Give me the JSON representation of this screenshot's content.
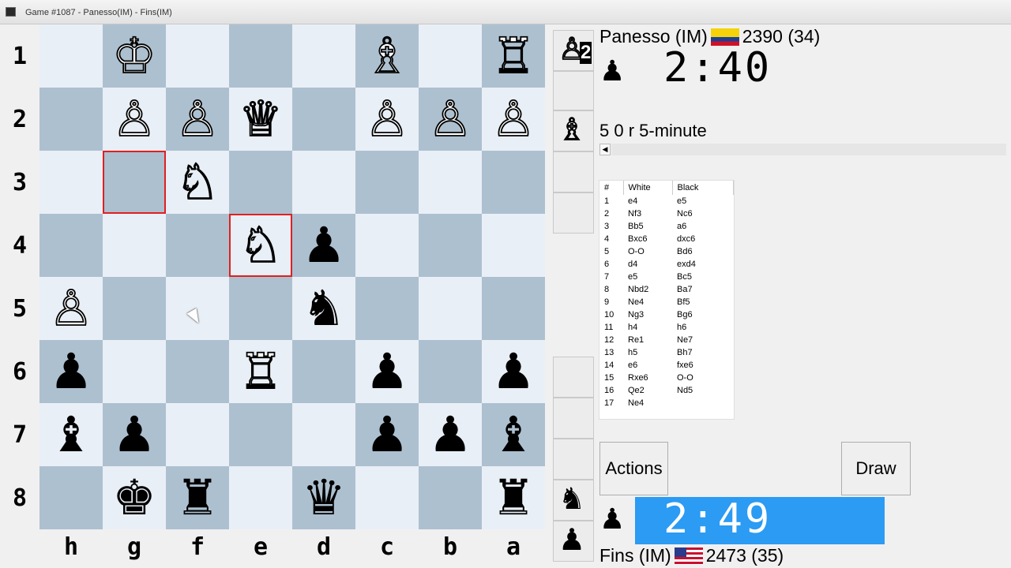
{
  "window": {
    "title": "Game #1087 - Panesso(IM) - Fins(IM)"
  },
  "board": {
    "rank_labels": [
      "1",
      "2",
      "3",
      "4",
      "5",
      "6",
      "7",
      "8"
    ],
    "file_labels": [
      "h",
      "g",
      "f",
      "e",
      "d",
      "c",
      "b",
      "a"
    ],
    "rows": [
      [
        "",
        "K",
        "",
        "",
        "",
        "B",
        "",
        "R"
      ],
      [
        "",
        "P",
        "P",
        "Q",
        "",
        "P",
        "P",
        "P"
      ],
      [
        "",
        "",
        "N",
        "",
        "",
        "",
        "",
        ""
      ],
      [
        "",
        "",
        "",
        "N",
        "p",
        "",
        "",
        ""
      ],
      [
        "P",
        "",
        "",
        "",
        "n",
        "",
        "",
        ""
      ],
      [
        "p",
        "",
        "",
        "R",
        "",
        "p",
        "",
        "p"
      ],
      [
        "b",
        "p",
        "",
        "",
        "",
        "p",
        "p",
        "b"
      ],
      [
        "",
        "k",
        "r",
        "",
        "q",
        "",
        "",
        "r"
      ]
    ],
    "highlighted": [
      "g3",
      "e4"
    ]
  },
  "captured": {
    "top": {
      "piece_icon": "white-pawn-icon",
      "glyph": "♙",
      "count": "2",
      "second_icon": "white-bishop-icon",
      "second_glyph": "♗"
    },
    "bottom": {
      "piece_icon": "black-knight-icon",
      "glyph": "♞",
      "second_icon": "black-pawn-icon",
      "second_glyph": "♟"
    }
  },
  "black_player": {
    "name": "Panesso (IM)",
    "rating": "2390 (34)",
    "flag": "colombia-flag-icon",
    "clock": "2:40"
  },
  "white_player": {
    "name": "Fins (IM)",
    "rating": "2473 (35)",
    "flag": "usa-flag-icon",
    "clock": "2:49",
    "clock_bg": "#2b9bf4"
  },
  "game_info": "5 0 r 5-minute",
  "moves": {
    "headers": [
      "#",
      "White",
      "Black"
    ],
    "rows": [
      [
        "1",
        "e4",
        "e5"
      ],
      [
        "2",
        "Nf3",
        "Nc6"
      ],
      [
        "3",
        "Bb5",
        "a6"
      ],
      [
        "4",
        "Bxc6",
        "dxc6"
      ],
      [
        "5",
        "O-O",
        "Bd6"
      ],
      [
        "6",
        "d4",
        "exd4"
      ],
      [
        "7",
        "e5",
        "Bc5"
      ],
      [
        "8",
        "Nbd2",
        "Ba7"
      ],
      [
        "9",
        "Ne4",
        "Bf5"
      ],
      [
        "10",
        "Ng3",
        "Bg6"
      ],
      [
        "11",
        "h4",
        "h6"
      ],
      [
        "12",
        "Re1",
        "Ne7"
      ],
      [
        "13",
        "h5",
        "Bh7"
      ],
      [
        "14",
        "e6",
        "fxe6"
      ],
      [
        "15",
        "Rxe6",
        "O-O"
      ],
      [
        "16",
        "Qe2",
        "Nd5"
      ],
      [
        "17",
        "Ne4",
        ""
      ]
    ]
  },
  "buttons": {
    "actions": "Actions",
    "draw": "Draw"
  },
  "colors": {
    "light_square": "#e9eff6",
    "dark_square": "#adc0d0",
    "highlight": "#e02020"
  }
}
